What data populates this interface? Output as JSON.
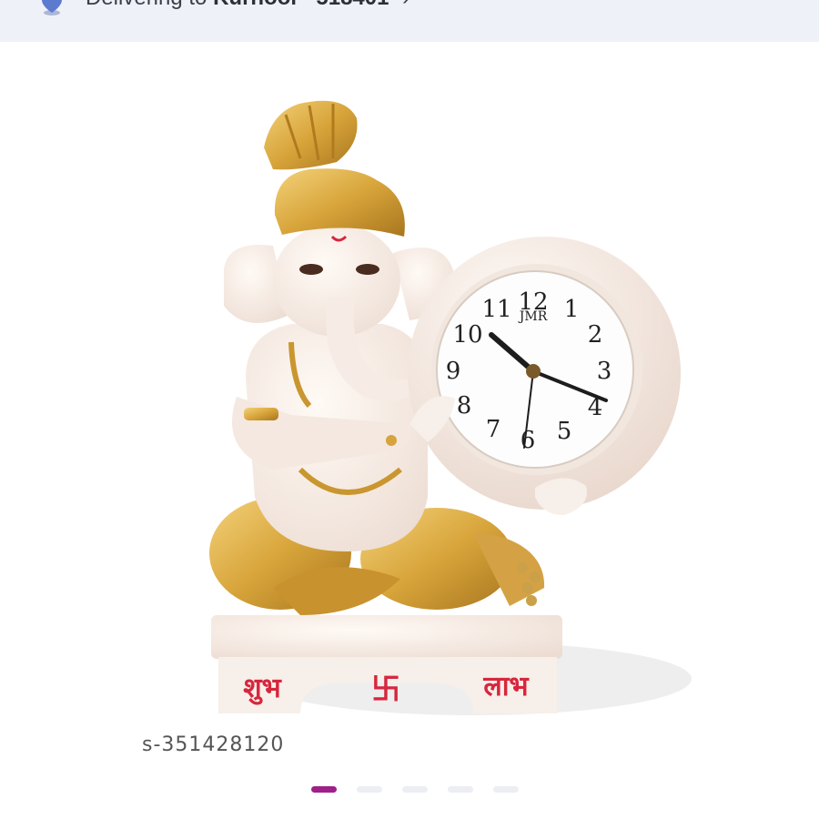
{
  "header": {
    "deliver_prefix": "Delivering to",
    "location": "Kurnool - 518401",
    "icon": "location-pin-icon"
  },
  "product": {
    "clock_brand": "JMR",
    "clock_numbers": [
      "12",
      "1",
      "2",
      "3",
      "4",
      "5",
      "6",
      "7",
      "8",
      "9",
      "10",
      "11"
    ],
    "base_left_text": "शुभ",
    "base_right_text": "लाभ",
    "base_center_symbol": "卐",
    "sku": "s-351428120"
  },
  "carousel": {
    "total": 5,
    "active_index": 0,
    "active_color": "#9f2089",
    "inactive_color": "#eceef3"
  }
}
